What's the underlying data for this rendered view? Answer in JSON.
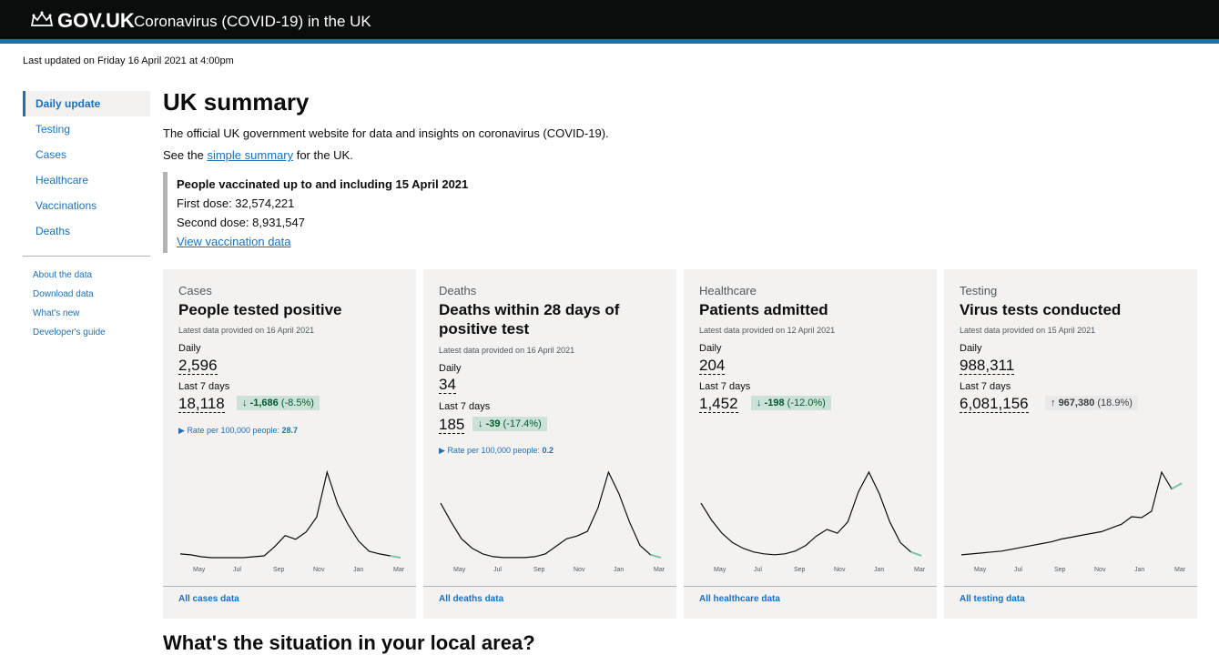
{
  "header": {
    "brand": "GOV.UK",
    "service": "Coronavirus (COVID-19) in the UK"
  },
  "last_updated": "Last updated on Friday 16 April 2021 at 4:00pm",
  "nav": {
    "items": [
      {
        "label": "Daily update"
      },
      {
        "label": "Testing"
      },
      {
        "label": "Cases"
      },
      {
        "label": "Healthcare"
      },
      {
        "label": "Vaccinations"
      },
      {
        "label": "Deaths"
      }
    ],
    "sub": [
      {
        "label": "About the data"
      },
      {
        "label": "Download data"
      },
      {
        "label": "What's new"
      },
      {
        "label": "Developer's guide"
      }
    ]
  },
  "main": {
    "title": "UK summary",
    "intro": "The official UK government website for data and insights on coronavirus (COVID-19).",
    "see_prefix": "See the",
    "see_link": "simple summary",
    "see_suffix": "for the UK."
  },
  "vaccination": {
    "title": "People vaccinated up to and including 15 April 2021",
    "first": "First dose: 32,574,221",
    "second": "Second dose: 8,931,547",
    "link": "View vaccination data"
  },
  "cards": [
    {
      "category": "Cases",
      "title": "People tested positive",
      "latest": "Latest data provided on 16 April 2021",
      "daily_label": "Daily",
      "daily": "2,596",
      "week_label": "Last 7 days",
      "week": "18,118",
      "change_arrow": "↓",
      "change_value": "-1,686",
      "change_pct": "(-8.5%)",
      "rate_label": "Rate per 100,000 people:",
      "rate_value": "28.7",
      "months": [
        "May",
        "Jul",
        "Sep",
        "Nov",
        "Jan",
        "Mar"
      ],
      "link": "All cases data"
    },
    {
      "category": "Deaths",
      "title": "Deaths within 28 days of positive test",
      "latest": "Latest data provided on 16 April 2021",
      "daily_label": "Daily",
      "daily": "34",
      "week_label": "Last 7 days",
      "week": "185",
      "change_arrow": "↓",
      "change_value": "-39",
      "change_pct": "(-17.4%)",
      "rate_label": "Rate per 100,000 people:",
      "rate_value": "0.2",
      "months": [
        "May",
        "Jul",
        "Sep",
        "Nov",
        "Jan",
        "Mar"
      ],
      "link": "All deaths data"
    },
    {
      "category": "Healthcare",
      "title": "Patients admitted",
      "latest": "Latest data provided on 12 April 2021",
      "daily_label": "Daily",
      "daily": "204",
      "week_label": "Last 7 days",
      "week": "1,452",
      "change_arrow": "↓",
      "change_value": "-198",
      "change_pct": "(-12.0%)",
      "months": [
        "May",
        "Jul",
        "Sep",
        "Nov",
        "Jan",
        "Mar"
      ],
      "link": "All healthcare data"
    },
    {
      "category": "Testing",
      "title": "Virus tests conducted",
      "latest": "Latest data provided on 15 April 2021",
      "daily_label": "Daily",
      "daily": "988,311",
      "week_label": "Last 7 days",
      "week": "6,081,156",
      "change_arrow": "↑",
      "change_value": "967,380",
      "change_pct": "(18.9%)",
      "months": [
        "May",
        "Jul",
        "Sep",
        "Nov",
        "Jan",
        "Mar"
      ],
      "link": "All testing data"
    }
  ],
  "bottom_heading": "What's the situation in your local area?",
  "colors": {
    "header": "#0b0c0c",
    "accent": "#1d70b8",
    "card": "#f3f2f1",
    "down_bg": "#cce2d8",
    "down_fg": "#005a30",
    "up_bg": "#e9e9e9"
  },
  "chart_data": [
    {
      "type": "line",
      "series": [
        {
          "values": [
            6,
            5,
            3,
            2,
            2,
            2,
            2,
            3,
            4,
            14,
            26,
            22,
            30,
            46,
            95,
            60,
            38,
            20,
            9,
            6,
            4,
            2
          ]
        }
      ],
      "x": [
        "May",
        "Jul",
        "Sep",
        "Nov",
        "Jan",
        "Mar"
      ]
    },
    {
      "type": "line",
      "series": [
        {
          "values": [
            60,
            40,
            22,
            12,
            6,
            3,
            2,
            2,
            2,
            3,
            6,
            14,
            22,
            25,
            30,
            55,
            93,
            70,
            40,
            15,
            5,
            2
          ]
        }
      ],
      "x": [
        "May",
        "Jul",
        "Sep",
        "Nov",
        "Jan",
        "Mar"
      ]
    },
    {
      "type": "line",
      "series": [
        {
          "values": [
            60,
            42,
            28,
            18,
            12,
            8,
            6,
            5,
            6,
            9,
            15,
            25,
            32,
            28,
            40,
            72,
            93,
            70,
            40,
            18,
            8,
            4
          ]
        }
      ],
      "x": [
        "May",
        "Jul",
        "Sep",
        "Nov",
        "Jan",
        "Mar"
      ]
    },
    {
      "type": "line",
      "series": [
        {
          "values": [
            5,
            6,
            7,
            8,
            9,
            11,
            13,
            15,
            17,
            19,
            22,
            24,
            26,
            28,
            30,
            34,
            38,
            46,
            45,
            52,
            94,
            76,
            82
          ]
        }
      ],
      "x": [
        "May",
        "Jul",
        "Sep",
        "Nov",
        "Jan",
        "Mar"
      ]
    }
  ]
}
